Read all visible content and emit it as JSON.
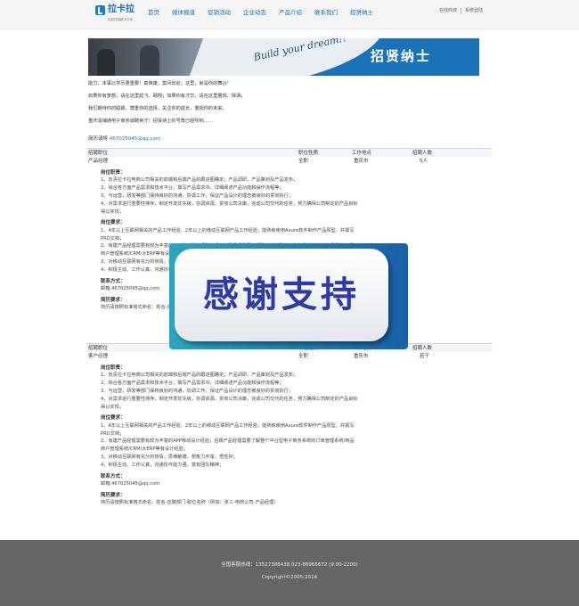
{
  "header": {
    "logo_name": "拉卡拉",
    "logo_sub": "智能终端解决方案",
    "nav": [
      "首页",
      "媒体报道",
      "促销活动",
      "企业动态",
      "产品介绍",
      "联系我们",
      "招贤纳士"
    ],
    "top_links": [
      "在线商城",
      "系统登陆"
    ]
  },
  "banner": {
    "script": "Build your dream!!",
    "title": "招贤纳士"
  },
  "intro": {
    "paragraphs": [
      "能力、本事比学历更重要！真英雄，莫问出处；这里，就是你的舞台！",
      "如果你有梦想，请在这里起飞、翱翔；如果你有才华，请在这里展现、挥洒；",
      "我们期待你的聪颖，尊重你的选择，关注你的成长，重视你的未来。",
      "重庆渝铺通电子商务诚聘英才！招贤纳士的号角已经吹响……"
    ],
    "email_label": "简历请将",
    "email": "467025045@qq.com"
  },
  "jobs": [
    {
      "headers": [
        "招聘职位",
        "职位性质",
        "工作地点",
        "招聘人数"
      ],
      "row": [
        "产品经理",
        "全职",
        "重庆市",
        "5人"
      ],
      "duties_title": "岗位职责：",
      "duties": [
        "1、负责拉卡拉电商公司相关的前端和后端产品的跟进图确定；产品调研、产品策划及产品发布；",
        "2、综合各方面产品需求和技术平台，撰写产品需求书，详细阐述产品功能和操作流程等；",
        "3、与运营，研发等部门保持良好的沟通，协调工作，保证产品设计的理念被良好的贯彻执行；",
        "4、对需求进行重要性排序，制定开发优先级，协调资源，贯彻公司决策，完成公司交代的任务，努力确保公司制定的产品目标",
        "得以实现；"
      ],
      "req_title": "岗位要求：",
      "reqs": [
        "1、4年以上互联网相关的产品工作经验，2年以上的移动互联网产品工作经验；能熟练使用Axure软件制作产品原型，并撰写",
        "PRD文档；",
        "2、有建产品经理需要有较为丰富的APP移动设计经验；后端产品经理需要了解整个平台型电子商务系统的订单管理系统/商品",
        "商户管理系统/CRM/大ERP等有设计经验；",
        "3、对移动互联网有充分的热情，思维敏捷，想象力丰富，悟性好；",
        "4、积极主动、工作认真，沟通协作能力强，富有团队精神；"
      ],
      "contact_title": "联系方式：",
      "contact": "邮箱:467025045@qq.com",
      "resume_title": "简历要求：",
      "resume": "简历请按照标准格式命名：姓名-应聘部门-职位名称（例如：张三-电商公司-产品经理）"
    },
    {
      "headers": [
        "招聘职位",
        "职位性质",
        "工作地点",
        "招聘人数"
      ],
      "row": [
        "客户经理",
        "全职",
        "重庆市",
        "若干"
      ],
      "duties_title": "岗位职责：",
      "duties": [
        "1、负责拉卡拉电商公司相关的前端和后端产品的跟进图确定；产品调研、产品策划及产品发布；",
        "2、综合各方面产品需求和技术平台，撰写产品需求书，详细阐述产品功能和操作流程等；",
        "3、与运营，研发等部门保持良好的沟通，协调工作，保证产品设计的理念被良好的贯彻执行；",
        "4、对需求进行重要性排序，制定开发优先级，协调资源，贯彻公司决策，完成公司交代的任务，努力确保公司制定的产品目标",
        "得以实现；"
      ],
      "req_title": "岗位要求：",
      "reqs": [
        "1、4年以上互联网相关的产品工作经验，2年以上的移动互联网产品工作经验；能熟练使用Axure软件制作产品原型，并撰写",
        "PRD文档；",
        "2、有建产品经理需要有较为丰富的APP移动设计经验；后端产品经理需要了解整个平台型电子商务系统的订单管理系统/商品",
        "商户管理系统/CRM/大ERP等有设计经验；",
        "3、对移动互联网有充分的热情，思维敏捷，想象力丰富，悟性好；",
        "4、积极主动、工作认真，沟通协作能力强，富有团队精神；"
      ],
      "contact_title": "联系方式：",
      "contact": "邮箱:467025045@qq.com",
      "resume_title": "简历要求：",
      "resume": "简历请按照标准格式命名：姓名-应聘部门-职位名称（例如：张三-电商公司-产品经理）"
    }
  ],
  "overlay": {
    "text": "感谢支持"
  },
  "footer": {
    "hotline": "全国客服热线：13527386438 023-86966672 (9:00-2200)",
    "copyright": "Copyright©2005-2014"
  }
}
